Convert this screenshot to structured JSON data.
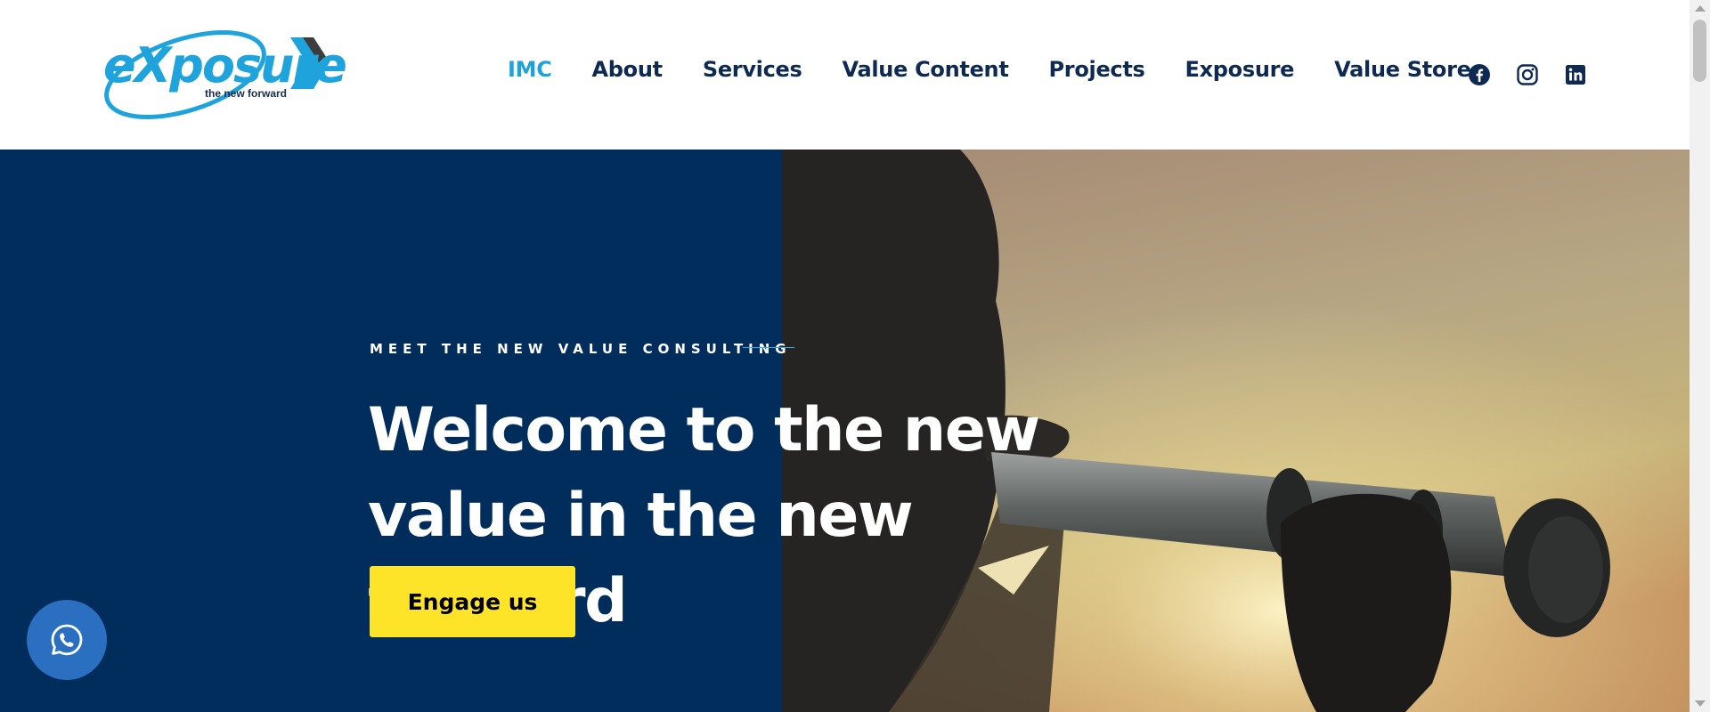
{
  "brand": {
    "logo_text": "eXposure",
    "tagline": "the new forward",
    "logo_color": "#1ea3dc"
  },
  "nav": {
    "items": [
      {
        "label": "IMC",
        "active": true
      },
      {
        "label": "About",
        "active": false
      },
      {
        "label": "Services",
        "active": false
      },
      {
        "label": "Value Content",
        "active": false
      },
      {
        "label": "Projects",
        "active": false
      },
      {
        "label": "Exposure",
        "active": false
      },
      {
        "label": "Value Store",
        "active": false
      }
    ],
    "active_color": "#1fa2dc",
    "text_color": "#0e2a52"
  },
  "social": {
    "icons": [
      "facebook-icon",
      "instagram-icon",
      "linkedin-icon"
    ]
  },
  "hero": {
    "eyebrow": "MEET THE NEW VALUE CONSULTING",
    "headline_line1": "Welcome to the new",
    "headline_line2": "value in the new forward",
    "cta_label": "Engage us",
    "panel_color": "#002d5b",
    "cta_color": "#fde428",
    "image_subject": "silhouette looking through telescope at sunset"
  },
  "floating": {
    "whatsapp_icon": "whatsapp-icon",
    "color": "#2b70c0"
  }
}
